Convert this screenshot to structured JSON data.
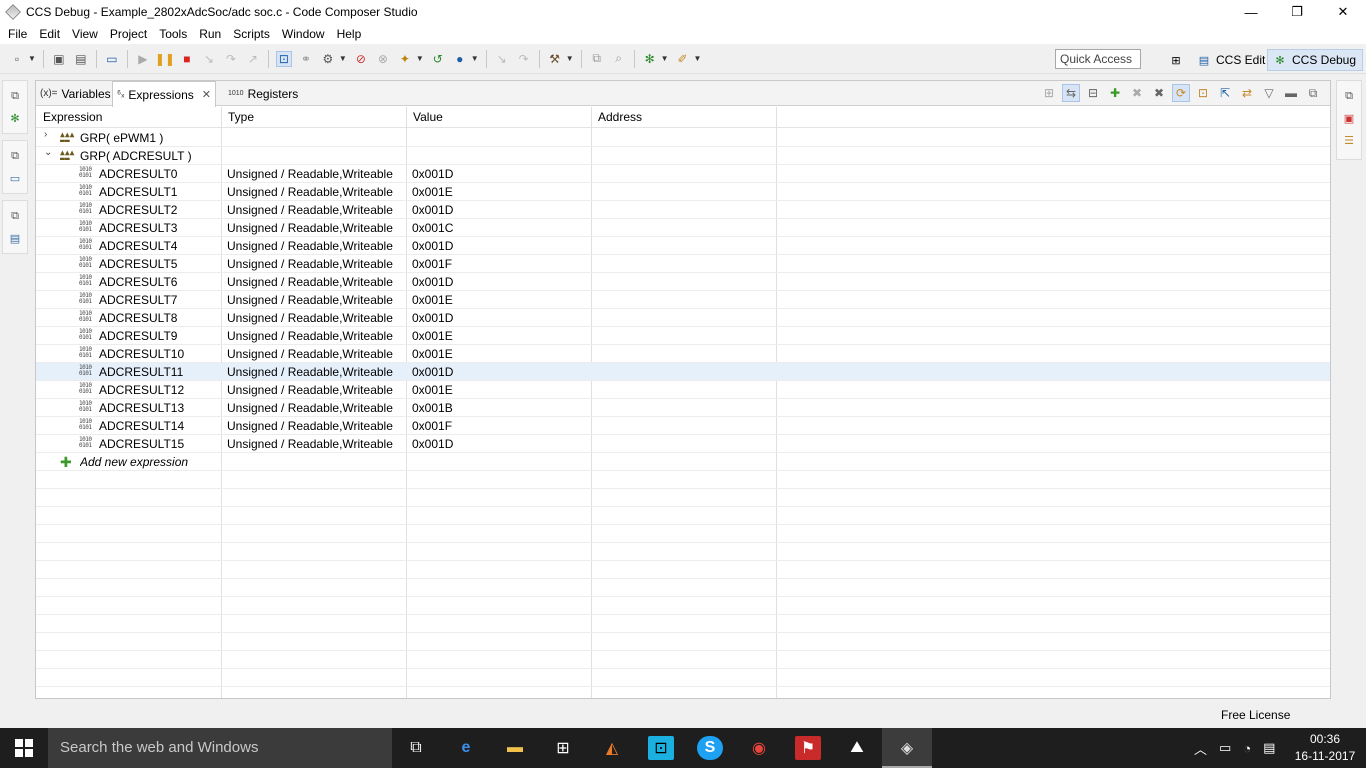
{
  "window": {
    "title": "CCS Debug - Example_2802xAdcSoc/adc soc.c - Code Composer Studio",
    "controls": [
      "—",
      "❐",
      "✕"
    ]
  },
  "menu": [
    "File",
    "Edit",
    "View",
    "Project",
    "Tools",
    "Run",
    "Scripts",
    "Window",
    "Help"
  ],
  "toolbar": {
    "quick_access_placeholder": "Quick Access",
    "perspectives": [
      {
        "label": "CCS Edit",
        "active": false
      },
      {
        "label": "CCS Debug",
        "active": true
      }
    ]
  },
  "view": {
    "tabs": [
      {
        "label": "Variables",
        "icon": "(x)=",
        "active": false
      },
      {
        "label": "Expressions",
        "icon": "⁶ₓ",
        "active": true,
        "close": "✕"
      },
      {
        "label": "Registers",
        "icon": "1010",
        "active": false
      }
    ],
    "columns": [
      "Expression",
      "Type",
      "Value",
      "Address"
    ],
    "groups": [
      {
        "label": "GRP( ePWM1 )",
        "expanded": false
      },
      {
        "label": "GRP( ADCRESULT )",
        "expanded": true
      }
    ],
    "registers": [
      {
        "name": "ADCRESULT0",
        "type": "Unsigned / Readable,Writeable",
        "value": "0x001D"
      },
      {
        "name": "ADCRESULT1",
        "type": "Unsigned / Readable,Writeable",
        "value": "0x001E"
      },
      {
        "name": "ADCRESULT2",
        "type": "Unsigned / Readable,Writeable",
        "value": "0x001D"
      },
      {
        "name": "ADCRESULT3",
        "type": "Unsigned / Readable,Writeable",
        "value": "0x001C"
      },
      {
        "name": "ADCRESULT4",
        "type": "Unsigned / Readable,Writeable",
        "value": "0x001D"
      },
      {
        "name": "ADCRESULT5",
        "type": "Unsigned / Readable,Writeable",
        "value": "0x001F"
      },
      {
        "name": "ADCRESULT6",
        "type": "Unsigned / Readable,Writeable",
        "value": "0x001D"
      },
      {
        "name": "ADCRESULT7",
        "type": "Unsigned / Readable,Writeable",
        "value": "0x001E"
      },
      {
        "name": "ADCRESULT8",
        "type": "Unsigned / Readable,Writeable",
        "value": "0x001D"
      },
      {
        "name": "ADCRESULT9",
        "type": "Unsigned / Readable,Writeable",
        "value": "0x001E"
      },
      {
        "name": "ADCRESULT10",
        "type": "Unsigned / Readable,Writeable",
        "value": "0x001E"
      },
      {
        "name": "ADCRESULT11",
        "type": "Unsigned / Readable,Writeable",
        "value": "0x001D",
        "selected": true
      },
      {
        "name": "ADCRESULT12",
        "type": "Unsigned / Readable,Writeable",
        "value": "0x001E"
      },
      {
        "name": "ADCRESULT13",
        "type": "Unsigned / Readable,Writeable",
        "value": "0x001B"
      },
      {
        "name": "ADCRESULT14",
        "type": "Unsigned / Readable,Writeable",
        "value": "0x001F"
      },
      {
        "name": "ADCRESULT15",
        "type": "Unsigned / Readable,Writeable",
        "value": "0x001D"
      }
    ],
    "add_new": "Add new expression"
  },
  "status": {
    "license": "Free License"
  },
  "taskbar": {
    "search_placeholder": "Search the web and Windows",
    "time": "00:36",
    "date": "16-11-2017"
  }
}
